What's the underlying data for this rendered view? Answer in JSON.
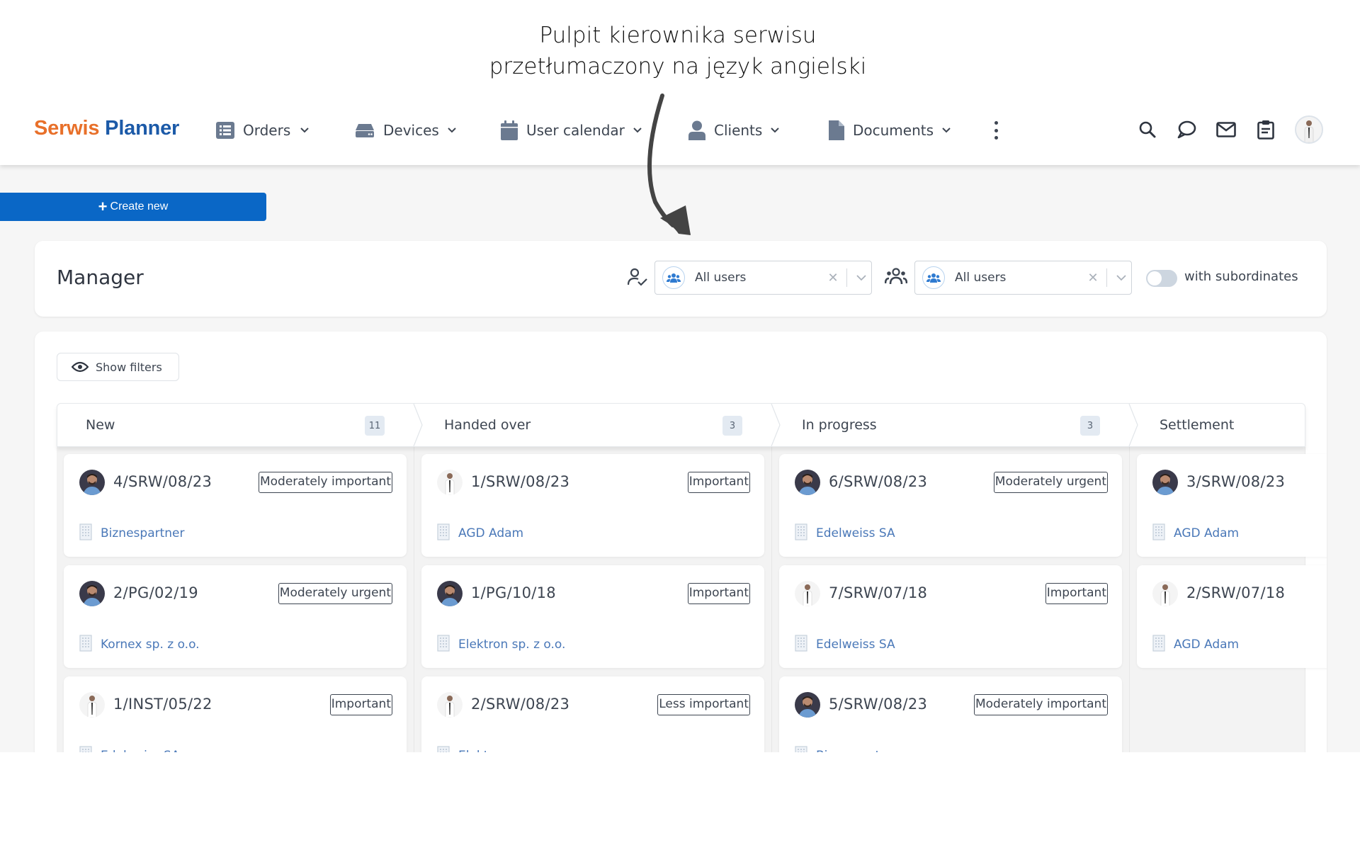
{
  "annotation": {
    "line1": "Pulpit kierownika serwisu",
    "line2": "przetłumaczony na język angielski"
  },
  "app": {
    "logo": {
      "part1": "Serwis",
      "part2": "Planner"
    },
    "colors": {
      "brand_orange": "#e8702a",
      "brand_blue": "#1c5aa8",
      "primary": "#0a67c6",
      "link": "#4a78b8"
    },
    "nav": [
      {
        "label": "Orders",
        "icon": "list-icon"
      },
      {
        "label": "Devices",
        "icon": "device-icon"
      },
      {
        "label": "User calendar",
        "icon": "calendar-icon"
      },
      {
        "label": "Clients",
        "icon": "user-icon"
      },
      {
        "label": "Documents",
        "icon": "document-icon"
      }
    ],
    "toolbar_icons": [
      "search-icon",
      "chat-icon",
      "mail-icon",
      "clipboard-icon",
      "avatar"
    ],
    "create_new_label": "Create new",
    "manager": {
      "title": "Manager",
      "filter1": {
        "value": "All users"
      },
      "filter2": {
        "value": "All users"
      },
      "toggle": {
        "label": "with subordinates",
        "checked": false
      }
    },
    "show_filters_label": "Show filters",
    "columns": [
      {
        "title": "New",
        "count": "11",
        "cards": [
          {
            "code": "4/SRW/08/23",
            "priority": "Moderately important",
            "client": "Biznespartner",
            "avatar": "dark"
          },
          {
            "code": "2/PG/02/19",
            "priority": "Moderately urgent",
            "client": "Kornex sp. z o.o.",
            "avatar": "dark"
          },
          {
            "code": "1/INST/05/22",
            "priority": "Important",
            "client": "Edelweiss SA",
            "avatar": "light"
          }
        ]
      },
      {
        "title": "Handed over",
        "count": "3",
        "cards": [
          {
            "code": "1/SRW/08/23",
            "priority": "Important",
            "client": "AGD Adam",
            "avatar": "light"
          },
          {
            "code": "1/PG/10/18",
            "priority": "Important",
            "client": "Elektron sp. z o.o.",
            "avatar": "dark"
          },
          {
            "code": "2/SRW/08/23",
            "priority": "Less important",
            "client": "Elektron",
            "avatar": "light"
          }
        ]
      },
      {
        "title": "In progress",
        "count": "3",
        "cards": [
          {
            "code": "6/SRW/08/23",
            "priority": "Moderately urgent",
            "client": "Edelweiss SA",
            "avatar": "dark"
          },
          {
            "code": "7/SRW/07/18",
            "priority": "Important",
            "client": "Edelweiss SA",
            "avatar": "light"
          },
          {
            "code": "5/SRW/08/23",
            "priority": "Moderately important",
            "client": "Biznespartner",
            "avatar": "dark"
          }
        ]
      },
      {
        "title": "Settlement",
        "count": "",
        "cards": [
          {
            "code": "3/SRW/08/23",
            "priority": "",
            "client": "AGD Adam",
            "avatar": "dark"
          },
          {
            "code": "2/SRW/07/18",
            "priority": "",
            "client": "AGD Adam",
            "avatar": "light"
          }
        ]
      }
    ]
  }
}
